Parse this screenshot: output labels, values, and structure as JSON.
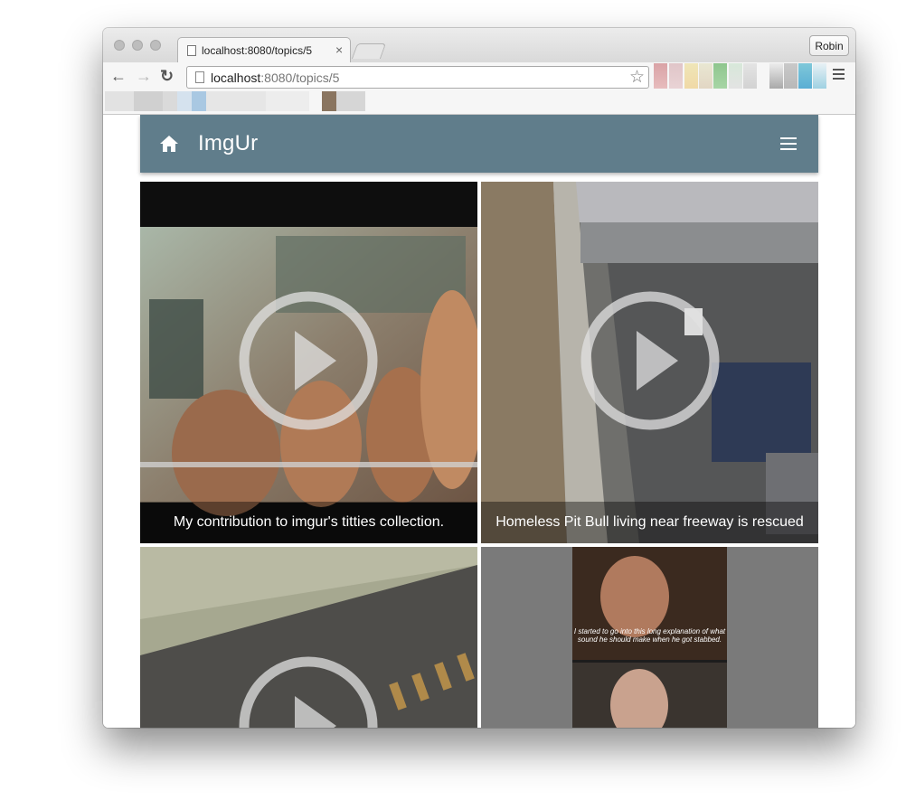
{
  "browser": {
    "tab_title": "localhost:8080/topics/5",
    "tab_close": "×",
    "profile": "Robin",
    "url_host": "localhost",
    "url_path": ":8080/topics/5",
    "star_glyph": "☆",
    "back_glyph": "←",
    "forward_glyph": "→",
    "reload_glyph": "↻"
  },
  "app": {
    "brand": "ImgUr",
    "accent_color": "#607d8b"
  },
  "posts": [
    {
      "caption": "My contribution to imgur's titties collection.",
      "type": "video"
    },
    {
      "caption": "Homeless Pit Bull living near freeway is rescued",
      "type": "video"
    },
    {
      "caption": "",
      "type": "video"
    },
    {
      "caption": "",
      "type": "image"
    }
  ],
  "gif_subtitle": "I started to go into this long explanation of what sound he should make when he got stabbed."
}
